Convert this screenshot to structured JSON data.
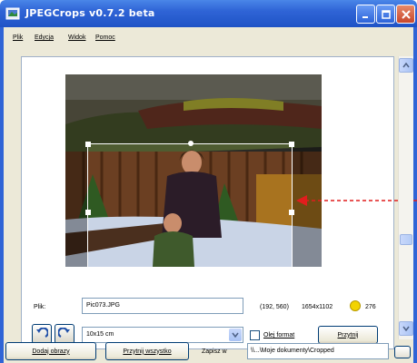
{
  "window": {
    "title": "JPEGCrops v0.7.2 beta"
  },
  "menu": {
    "items": [
      "Plik",
      "Edycja",
      "Widok",
      "Pomoc"
    ]
  },
  "icons": {
    "app": "app-icon",
    "minimize": "minimize-icon",
    "maximize": "maximize-icon",
    "close": "close-icon",
    "rotate_left": "rotate-left-icon",
    "rotate_right": "rotate-right-icon"
  },
  "file_row": {
    "label": "Plik:",
    "filename": "Pic073.JPG",
    "coords": "(192, 560)",
    "dimensions": "1654x1102",
    "counter": "276"
  },
  "controls_row": {
    "format_value": "10x15 cm",
    "ignore_format_label": "Olej format",
    "action_button": "Przytnij"
  },
  "bottom_row": {
    "add_images": "Dodaj obrazy",
    "crop_all": "Przytnij wszystko",
    "save_in_label": "Zapisz w",
    "save_path": "\\\\...\\Moje dokumenty\\Cropped"
  },
  "colors": {
    "titlebar": "#2f64d6",
    "crop_border": "#ffffff",
    "arrow": "#e11d1d",
    "indicator": "#f2d300"
  }
}
